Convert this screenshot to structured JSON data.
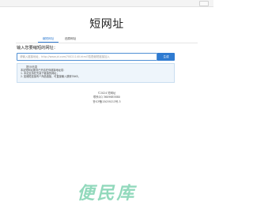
{
  "header": {
    "title": "短网址"
  },
  "tabs": [
    {
      "label": "缩短网址",
      "active": true
    },
    {
      "label": "还原网址",
      "active": false
    }
  ],
  "form": {
    "prompt": "输入您要缩短的网址：",
    "input_placeholder": "请输入链接地址，http://www.jd.com/?0021140.html?若是缩短链接加入",
    "input_value": "",
    "submit_label": "生成"
  },
  "notice": {
    "title": "提示信息",
    "lines": [
      "本站短网址服务已开启在你链接地址前：",
      "1. 本站支持在先读下链接的网址；",
      "2. 如缩短连接有个商品链接，可直接输入跳转TAKE。"
    ]
  },
  "footer": {
    "lines": [
      "©2024   短网址",
      "联系QQ 3609685880",
      "鲁ICP备15039213号-3"
    ]
  },
  "watermark": {
    "text": "便民库"
  },
  "colors": {
    "accent": "#2f7bd1",
    "notice_bg": "#eef5fb",
    "watermark": "#7fd3b1"
  }
}
